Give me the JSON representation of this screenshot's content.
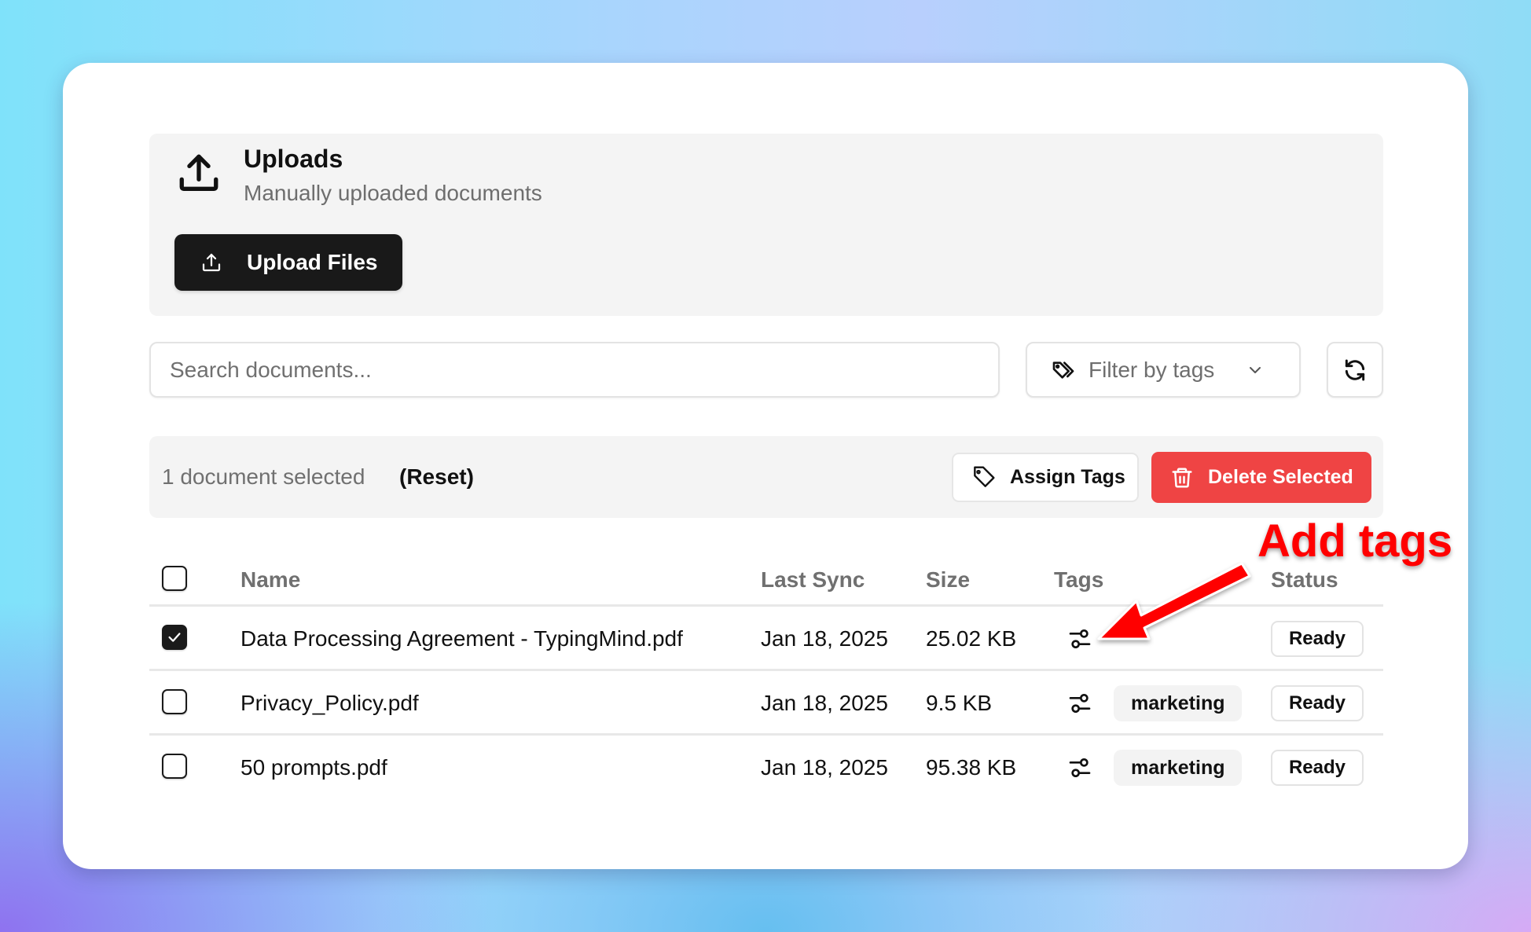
{
  "upload_section": {
    "title": "Uploads",
    "subtitle": "Manually uploaded documents",
    "icon": "upload-icon",
    "upload_button_label": "Upload Files"
  },
  "toolbar": {
    "search_placeholder": "Search documents...",
    "search_value": "",
    "filter_label": "Filter by tags",
    "filter_icon": "tags-icon",
    "refresh_icon": "refresh-icon"
  },
  "selection_bar": {
    "count_text": "1 document selected",
    "reset_label": "(Reset)",
    "assign_tags_label": "Assign Tags",
    "delete_selected_label": "Delete Selected",
    "delete_color": "#ef4444"
  },
  "table": {
    "columns": [
      "Name",
      "Last Sync",
      "Size",
      "Tags",
      "Status"
    ],
    "header_checked": false,
    "rows": [
      {
        "checked": true,
        "name": "Data Processing Agreement - TypingMind.pdf",
        "last_sync": "Jan 18, 2025",
        "size": "25.02 KB",
        "tags": [],
        "status": "Ready"
      },
      {
        "checked": false,
        "name": "Privacy_Policy.pdf",
        "last_sync": "Jan 18, 2025",
        "size": "9.5 KB",
        "tags": [
          "marketing"
        ],
        "status": "Ready"
      },
      {
        "checked": false,
        "name": "50 prompts.pdf",
        "last_sync": "Jan 18, 2025",
        "size": "95.38 KB",
        "tags": [
          "marketing"
        ],
        "status": "Ready"
      }
    ]
  },
  "annotation": {
    "text": "Add tags",
    "color": "#ff0000"
  }
}
